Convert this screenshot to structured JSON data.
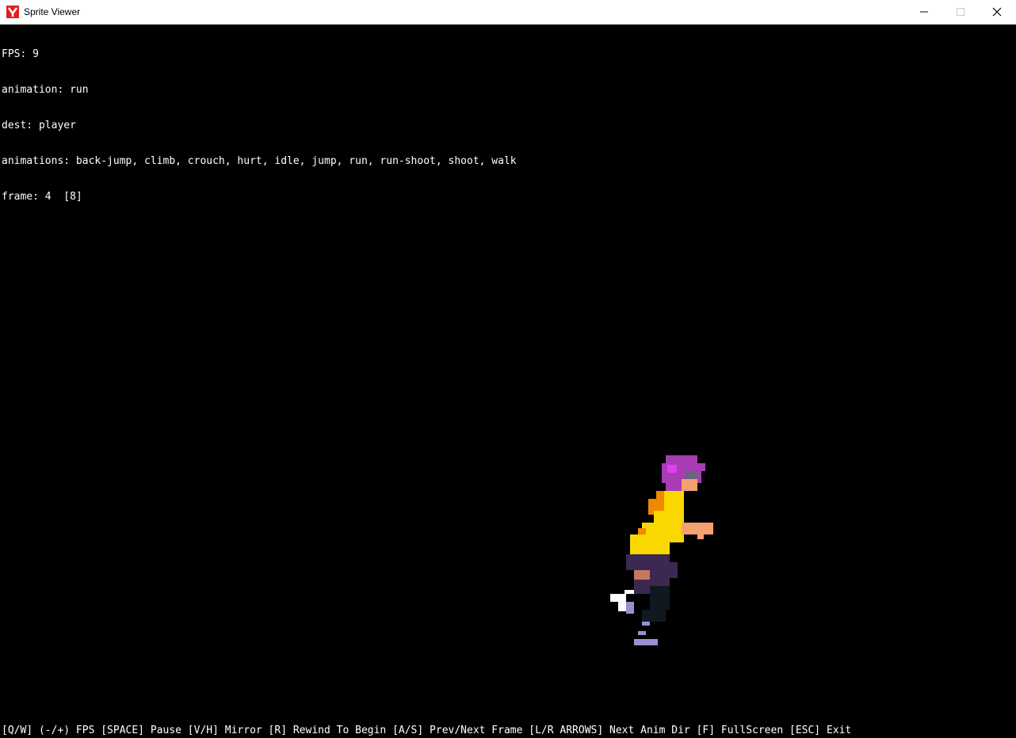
{
  "window": {
    "title": "Sprite Viewer",
    "icon": "app-icon",
    "buttons": {
      "minimize": "minimize-icon",
      "maximize": "maximize-icon",
      "close": "close-icon"
    }
  },
  "info": {
    "fps": "FPS: 9",
    "animation": "animation: run",
    "dest": "dest: player",
    "animations": "animations: back-jump, climb, crouch, hurt, idle, jump, run, run-shoot, shoot, walk",
    "frame": "frame: 4  [8]"
  },
  "footer": {
    "help": "[Q/W] (-/+) FPS [SPACE] Pause [V/H] Mirror [R] Rewind To Begin [A/S] Prev/Next Frame [L/R ARROWS] Next Anim Dir [F] FullScreen [ESC] Exit"
  },
  "sprite": {
    "name": "player",
    "animation": "run",
    "colors": {
      "hair": "#a83cb4",
      "hair_highlight": "#e040f0",
      "skin": "#f4a070",
      "shirt": "#f8d800",
      "shirt_shade": "#f08800",
      "pants": "#3c2850",
      "shoe_white": "#ffffff",
      "shoe_lavender": "#9890d0",
      "dark": "#101820"
    }
  }
}
